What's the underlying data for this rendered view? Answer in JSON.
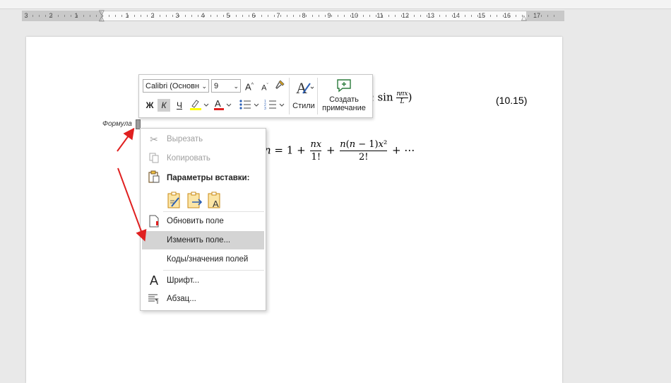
{
  "ruler": {
    "numbers": [
      "3",
      "2",
      "1",
      "1",
      "2",
      "3",
      "4",
      "5",
      "6",
      "7",
      "8",
      "9",
      "10",
      "11",
      "12",
      "13",
      "14",
      "15",
      "16",
      "17"
    ]
  },
  "document": {
    "formula_label": "Формула",
    "equation_number": "(10.15)",
    "equation_top": {
      "prefix": " ",
      "trail": "𝑛",
      "sin": "sin",
      "frac_num": "𝑛𝜋𝑥",
      "frac_den": "𝐿",
      "close": ")"
    },
    "equation_series": {
      "lead": "𝑛 = 1 +",
      "frac1_num": "𝑛𝑥",
      "frac1_den": "1!",
      "plus": "+",
      "frac2_num": "𝑛(𝑛 − 1)𝑥²",
      "frac2_den": "2!",
      "tail": "+ ⋯"
    }
  },
  "mini_toolbar": {
    "font_name": "Calibri (Основн",
    "font_size": "9",
    "bold": "Ж",
    "italic": "К",
    "underline": "Ч",
    "styles_label": "Стили",
    "comment_label_1": "Создать",
    "comment_label_2": "примечание",
    "colors": {
      "highlight": "#ffff00",
      "font_color": "#e02020",
      "accent": "#2b7a3b"
    }
  },
  "context_menu": {
    "cut": "Вырезать",
    "copy": "Копировать",
    "paste_options": "Параметры вставки:",
    "update_field": "Обновить поле",
    "edit_field": "Изменить поле...",
    "toggle_codes": "Коды/значения полей",
    "font": "Шрифт...",
    "paragraph": "Абзац..."
  },
  "annotation": {
    "arrow_color": "#e02020"
  }
}
